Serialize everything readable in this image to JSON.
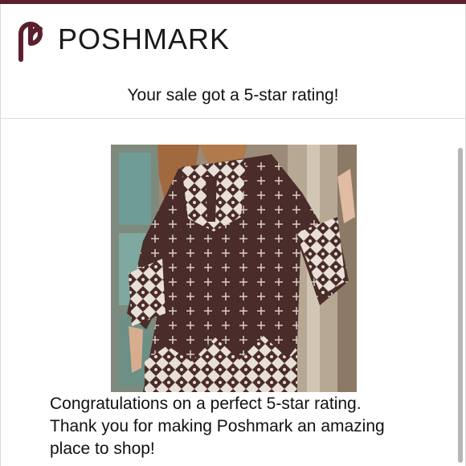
{
  "brand": {
    "name": "POSHMARK",
    "accent": "#5b1f2e"
  },
  "header": {
    "subject": "Your sale got a 5-star rating!"
  },
  "product_image": {
    "description_icon": "tunic-dress-photo"
  },
  "message": {
    "line1": "Congratulations on a perfect 5-star rating.",
    "line2": "Thank you for making Poshmark an amazing",
    "line3": "place to shop!"
  }
}
